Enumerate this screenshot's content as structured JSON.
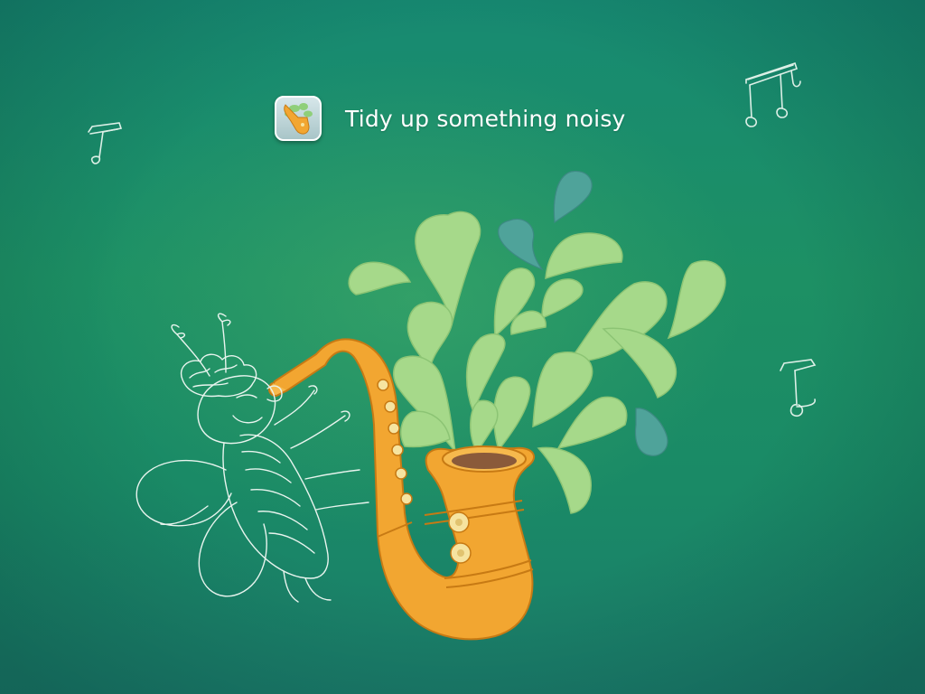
{
  "header": {
    "title": "Tidy up something noisy",
    "icon": "saxophone-app-icon"
  },
  "scene": {
    "instrument": "saxophone",
    "character": "sketched-bee",
    "decorations": [
      "music-note-icon",
      "double-note-icon",
      "music-note-icon"
    ]
  },
  "colors": {
    "background": "#1b8c6a",
    "saxophone": "#f2a631",
    "splash": "#a6d98a",
    "drop": "#4fa39a",
    "sketch": "#e8f4ee"
  }
}
